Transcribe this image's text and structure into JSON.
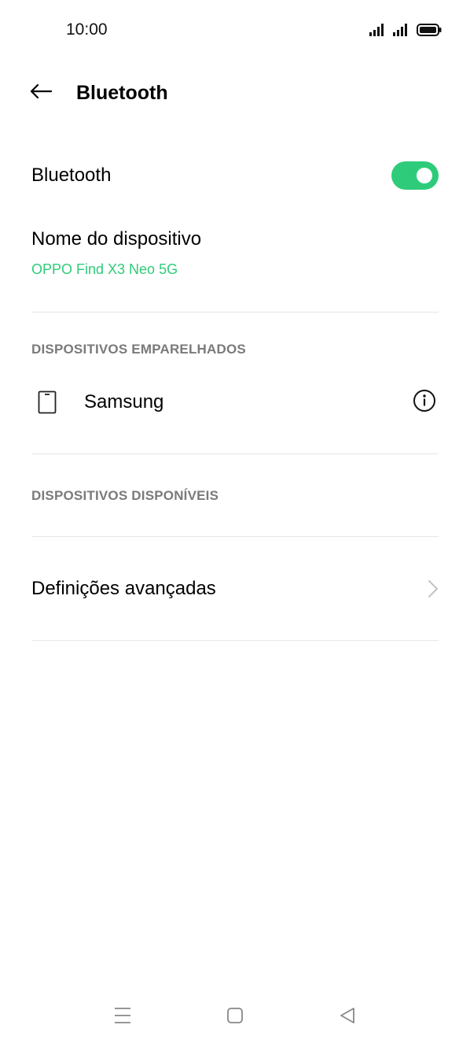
{
  "status_bar": {
    "time": "10:00",
    "icons": [
      "signal-icon",
      "signal-icon",
      "battery-icon"
    ]
  },
  "header": {
    "back_icon": "arrow-left-icon",
    "title": "Bluetooth"
  },
  "bluetooth_toggle": {
    "label": "Bluetooth",
    "enabled": true,
    "accent_color": "#2ecc7a"
  },
  "device_name": {
    "label": "Nome do dispositivo",
    "value": "OPPO Find X3 Neo 5G"
  },
  "paired_devices": {
    "header": "DISPOSITIVOS EMPARELHADOS",
    "items": [
      {
        "name": "Samsung",
        "icon": "phone-icon",
        "action_icon": "info-icon"
      }
    ]
  },
  "available_devices": {
    "header": "DISPOSITIVOS DISPONÍVEIS"
  },
  "advanced": {
    "label": "Definições avançadas",
    "icon": "chevron-right-icon"
  },
  "nav_bar": {
    "buttons": [
      "menu-icon",
      "home-icon",
      "back-triangle-icon"
    ]
  }
}
